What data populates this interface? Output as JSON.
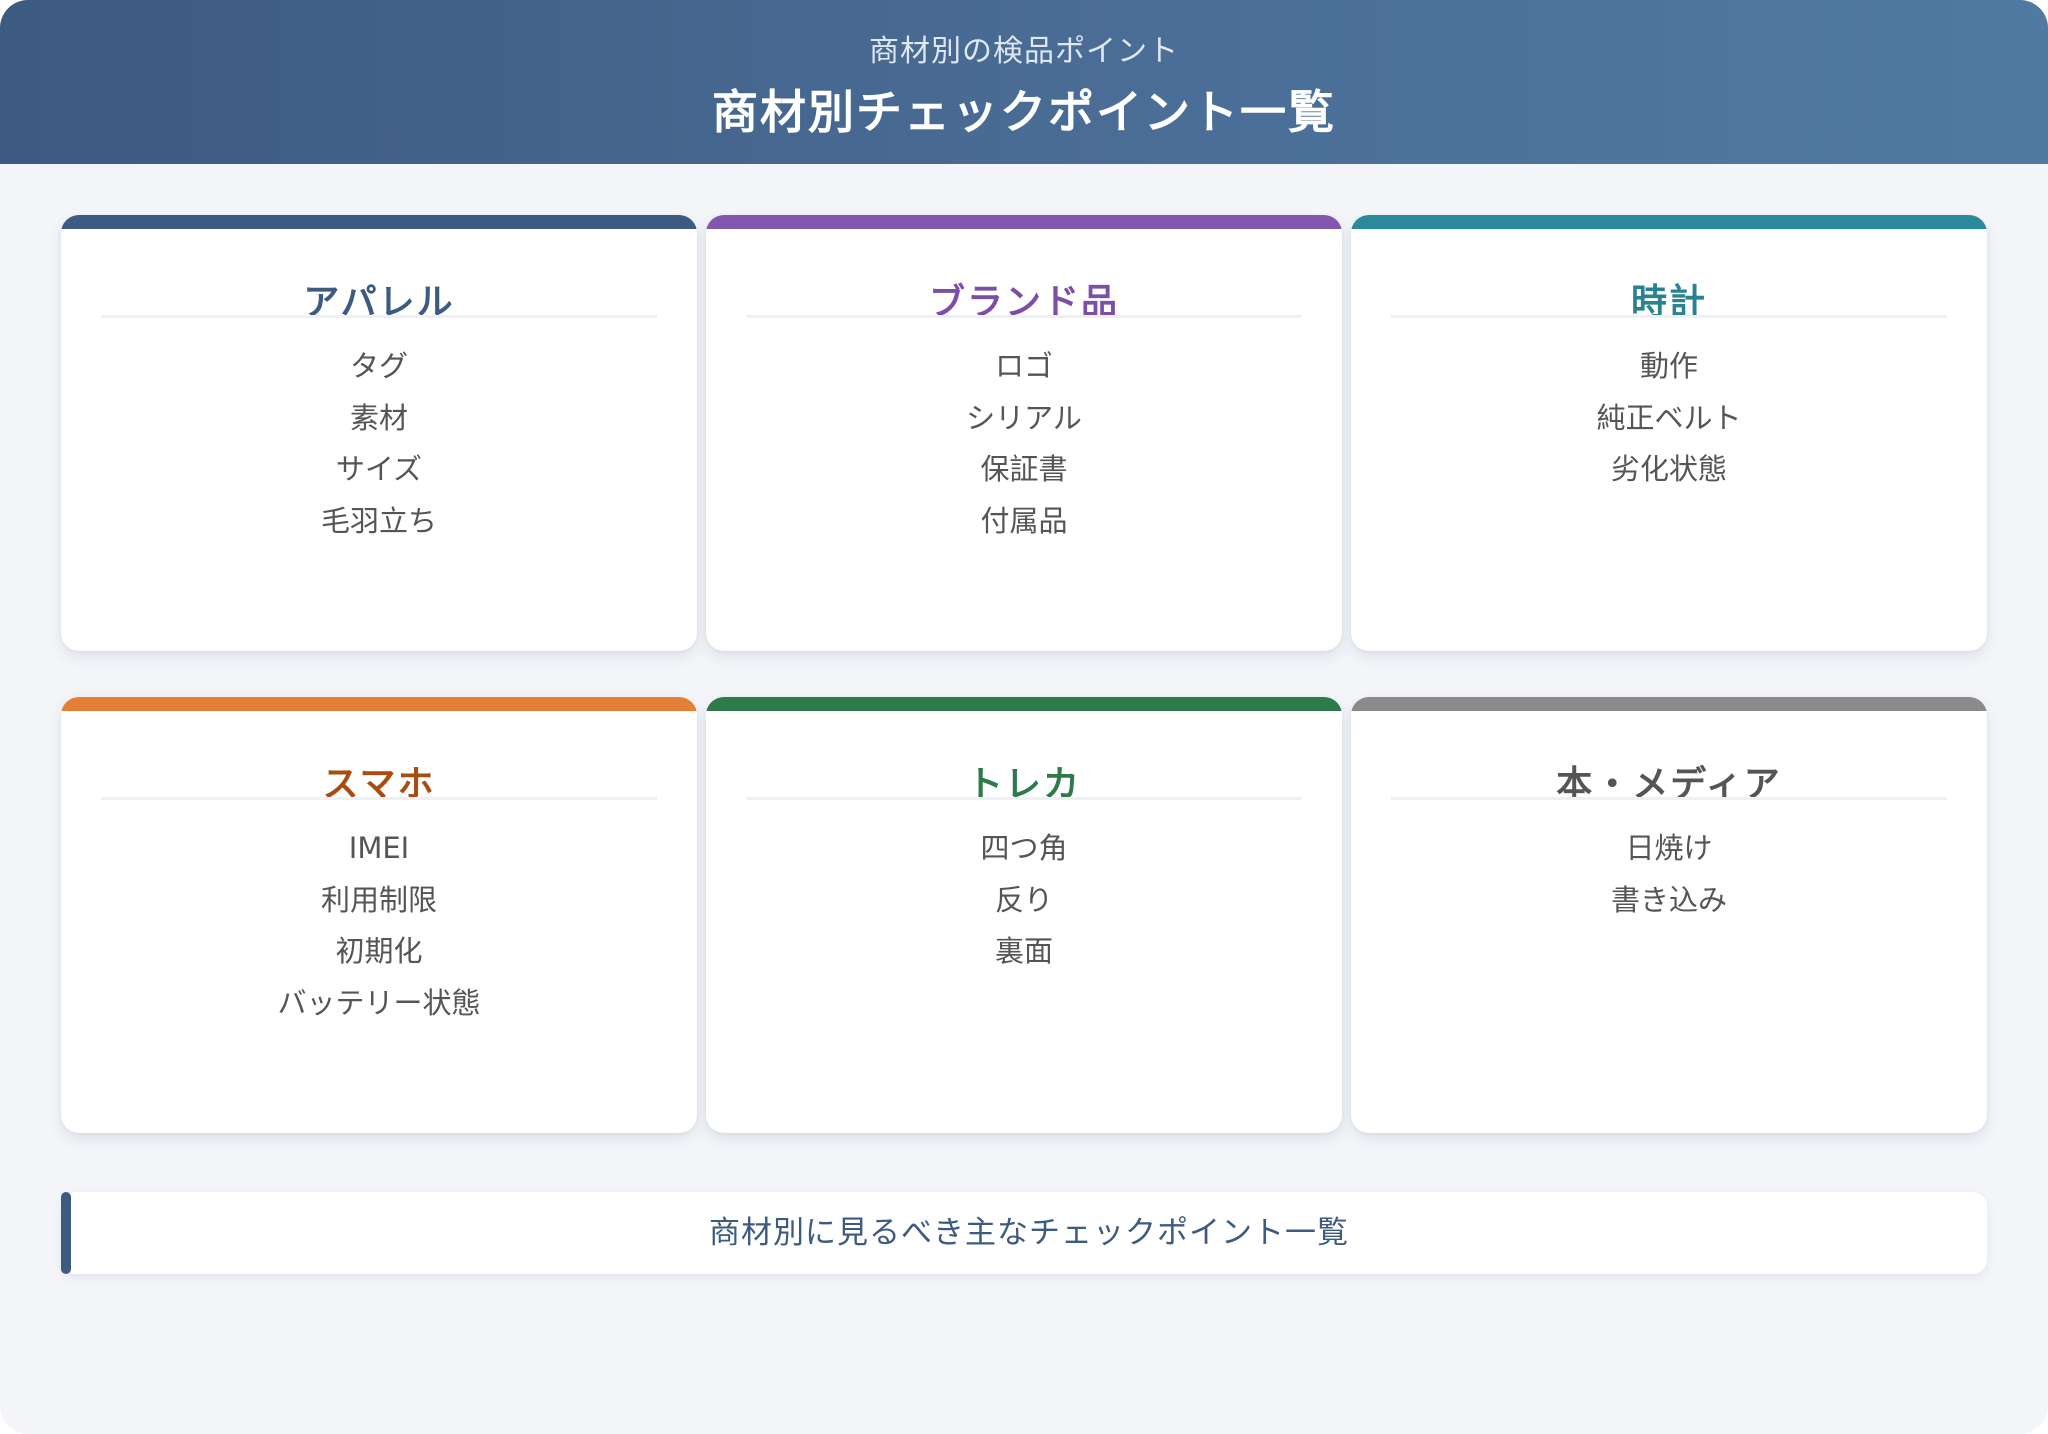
{
  "header": {
    "subtitle": "商材別の検品ポイント",
    "title": "商材別チェックポイント一覧"
  },
  "categories": [
    {
      "title": "アパレル",
      "accent_color": "#3d5a80",
      "title_color": "#3d5a80",
      "items": [
        "タグ",
        "素材",
        "サイズ",
        "毛羽立ち"
      ]
    },
    {
      "title": "ブランド品",
      "accent_color": "#8157b0",
      "title_color": "#7d4ea8",
      "items": [
        "ロゴ",
        "シリアル",
        "保証書",
        "付属品"
      ]
    },
    {
      "title": "時計",
      "accent_color": "#2a8a99",
      "title_color": "#2a8290",
      "items": [
        "動作",
        "純正ベルト",
        "劣化状態"
      ]
    },
    {
      "title": "スマホ",
      "accent_color": "#e47f35",
      "title_color": "#a84c12",
      "items": [
        "IMEI",
        "利用制限",
        "初期化",
        "バッテリー状態"
      ]
    },
    {
      "title": "トレカ",
      "accent_color": "#2e7a4b",
      "title_color": "#2e7a4b",
      "items": [
        "四つ角",
        "反り",
        "裏面"
      ]
    },
    {
      "title": "本・メディア",
      "accent_color": "#8a8a8a",
      "title_color": "#555555",
      "items": [
        "日焼け",
        "書き込み"
      ]
    }
  ],
  "footer": {
    "note": "商材別に見るべき主なチェックポイント一覧"
  }
}
